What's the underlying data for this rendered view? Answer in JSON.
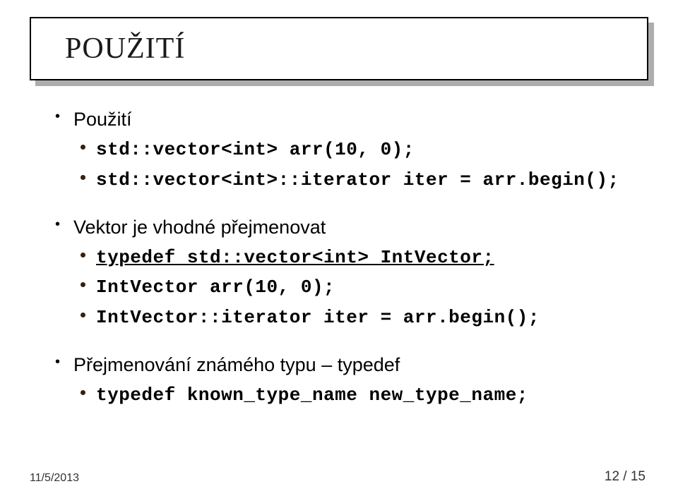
{
  "title": "POUŽITÍ",
  "blocks": [
    {
      "heading": "Použití",
      "items": [
        {
          "text": "std::vector<int> arr(10, 0);",
          "underline": false
        },
        {
          "text": "std::vector<int>::iterator iter = arr.begin();",
          "underline": false
        }
      ]
    },
    {
      "heading": "Vektor je vhodné přejmenovat",
      "items": [
        {
          "text": "typedef std::vector<int> IntVector;",
          "underline": true
        },
        {
          "text": "IntVector arr(10, 0);",
          "underline": false
        },
        {
          "text": "IntVector::iterator iter = arr.begin();",
          "underline": false
        }
      ]
    },
    {
      "heading": "Přejmenování známého typu – typedef",
      "items": [
        {
          "text": "typedef known_type_name new_type_name;",
          "underline": false
        }
      ]
    }
  ],
  "footer": {
    "date": "11/5/2013",
    "page": "12 / 15"
  }
}
